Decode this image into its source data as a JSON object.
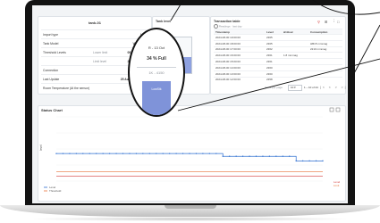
{
  "device": {
    "title": "tank-01",
    "rows": [
      {
        "label": "Import type",
        "mid": "",
        "value": "LSD"
      },
      {
        "label": "Tank Model",
        "mid": "",
        "value": "VEB 6863"
      },
      {
        "label": "Threshold Levels",
        "mid": "Lower limit",
        "value": "0000 mmmag"
      },
      {
        "label": "",
        "mid": "Limit level",
        "value": "3045 mmmag"
      },
      {
        "label": "Connection",
        "mid": "",
        "value": "Online"
      },
      {
        "label": "Last Update",
        "mid": "",
        "value": "25 Aug 2024 18:30"
      },
      {
        "label": "Room Temperature (At the sensor)",
        "mid": "",
        "value": "20 °C"
      }
    ]
  },
  "tank": {
    "title": "Tank level",
    "level_fraction": 0.45,
    "lens_lines": [
      "R - 13 Oct",
      "34 % Full",
      "1K - 4150"
    ],
    "fill_label": "LowStk"
  },
  "trend": {
    "title": "Transaction table",
    "subtitle": "Readings · last day",
    "columns": [
      "Timestamp",
      "Level",
      "Δ1Hour",
      "Consumption"
    ],
    "rows": [
      [
        "2024-08-00 19:00:00",
        "2365",
        "",
        ""
      ],
      [
        "2024-08-00 18:00:00",
        "2365",
        "",
        "HB15 mmmag"
      ],
      [
        "2024-08-00 17:00:00",
        "2362",
        "",
        "2210 mmmag"
      ],
      [
        "2024-08-00 16:00:00",
        "2361",
        "1.8 mmmag",
        ""
      ],
      [
        "2024-08-00 15:00:00",
        "2361",
        "",
        ""
      ],
      [
        "2024-08-00 14:00:00",
        "2360",
        "",
        ""
      ],
      [
        "2024-08-00 13:00:00",
        "2360",
        "",
        ""
      ],
      [
        "2024-08-00 12:00:00",
        "2358",
        "",
        ""
      ]
    ],
    "pager_label": "Items per page",
    "page_size": "10",
    "page_range": "1 – 10 of 24"
  },
  "chart": {
    "title": "Status Chart",
    "y_title": "level",
    "legend": [
      "Level",
      "Threshold"
    ],
    "right_labels": [
      "Level",
      "Limit"
    ],
    "colors": {
      "blue": "#2f6fd0",
      "orange": "#e8743b",
      "red": "#d33b3b",
      "grey": "#8a8f96"
    }
  },
  "chart_data": {
    "type": "line",
    "x": [
      0,
      1,
      2,
      3,
      4,
      5,
      6,
      7,
      8,
      9,
      10,
      11,
      12,
      13,
      14,
      15,
      16,
      17,
      18,
      19,
      20,
      21,
      22,
      23,
      24,
      25,
      26,
      27,
      28,
      29,
      30,
      31,
      32,
      33,
      34,
      35,
      36,
      37,
      38,
      39,
      40
    ],
    "series": [
      {
        "name": "Level",
        "values": [
          14,
          14,
          14,
          14,
          14,
          14,
          14,
          14,
          14,
          14,
          14,
          14,
          14,
          14,
          14,
          14,
          14,
          14,
          14,
          14,
          14,
          14,
          14,
          14,
          14,
          13.4,
          13.4,
          13.4,
          13.4,
          13.4,
          13.4,
          13.4,
          13.4,
          13.4,
          13.4,
          13.4,
          12.4,
          12.4,
          12.4,
          12.4,
          12.4
        ]
      },
      {
        "name": "Threshold",
        "values": [
          10,
          10,
          10,
          10,
          10,
          10,
          10,
          10,
          10,
          10,
          10,
          10,
          10,
          10,
          10,
          10,
          10,
          10,
          10,
          10,
          10,
          10,
          10,
          10,
          10,
          10,
          10,
          10,
          10,
          10,
          10,
          10,
          10,
          10,
          10,
          10,
          10,
          10,
          10,
          10,
          10
        ]
      },
      {
        "name": "Limit",
        "values": [
          9.1,
          9.1,
          9.1,
          9.1,
          9.1,
          9.1,
          9.1,
          9.1,
          9.1,
          9.1,
          9.1,
          9.1,
          9.1,
          9.1,
          9.1,
          9.1,
          9.1,
          9.1,
          9.1,
          9.1,
          9.1,
          9.1,
          9.1,
          9.1,
          9.1,
          9.1,
          9.1,
          9.1,
          9.1,
          9.1,
          9.1,
          9.1,
          9.1,
          9.1,
          9.1,
          9.1,
          9.1,
          9.1,
          9.1,
          9.1,
          9.1
        ]
      }
    ],
    "ylim": [
      8,
      22
    ]
  }
}
